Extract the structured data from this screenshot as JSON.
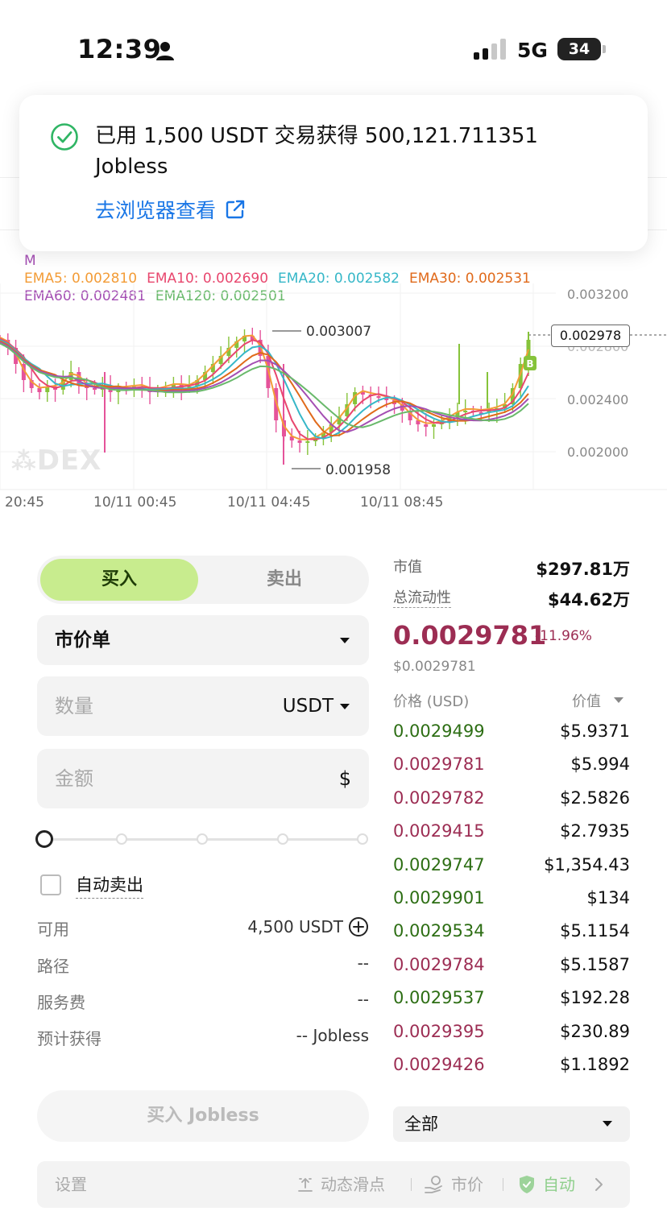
{
  "status_bar": {
    "time": "12:39",
    "network": "5G",
    "battery": "34"
  },
  "toast": {
    "message": "已用 1,500 USDT 交易获得 500,121.711351 Jobless",
    "link": "去浏览器查看"
  },
  "chart": {
    "ema_line1": [
      {
        "label": "EMA5: 0.002810",
        "color": "#f39c37"
      },
      {
        "label": "EMA10: 0.002690",
        "color": "#e8476e"
      },
      {
        "label": "EMA20: 0.002582",
        "color": "#36b7c8"
      },
      {
        "label": "EMA30: 0.002531",
        "color": "#e06a1b"
      }
    ],
    "ema_line2": [
      {
        "label": "EMA60: 0.002481",
        "color": "#a44fb3"
      },
      {
        "label": "EMA120: 0.002501",
        "color": "#69b96b"
      }
    ],
    "ema_partial": "M",
    "price_axis": [
      "0.003200",
      "0.002800",
      "0.002400",
      "0.002000"
    ],
    "current_price_tag": "0.002978",
    "high_note": "0.003007",
    "low_note": "0.001958",
    "time_axis": [
      "20:45",
      "10/11 00:45",
      "10/11 04:45",
      "10/11 08:45"
    ],
    "watermark": "DEX",
    "marker": "B"
  },
  "trade_panel": {
    "tab_buy": "买入",
    "tab_sell": "卖出",
    "order_type": "市价单",
    "quantity_placeholder": "数量",
    "quantity_unit": "USDT",
    "amount_placeholder": "金额",
    "amount_unit": "$",
    "auto_sell": "自动卖出",
    "available_label": "可用",
    "available_value": "4,500 USDT",
    "route_label": "路径",
    "route_value": "--",
    "fee_label": "服务费",
    "fee_value": "--",
    "expected_label": "预计获得",
    "expected_value": "-- Jobless",
    "buy_button": "买入 Jobless"
  },
  "market": {
    "mcap_label": "市值",
    "mcap_value": "$297.81万",
    "liquidity_label": "总流动性",
    "liquidity_value": "$44.62万",
    "price": "0.0029781",
    "change": "-11.96%",
    "usd_price": "$0.0029781",
    "col_price": "价格 (USD)",
    "col_value": "价值",
    "trades": [
      {
        "price": "0.0029499",
        "value": "$5.9371",
        "side": "buy"
      },
      {
        "price": "0.0029781",
        "value": "$5.994",
        "side": "sell"
      },
      {
        "price": "0.0029782",
        "value": "$2.5826",
        "side": "sell"
      },
      {
        "price": "0.0029415",
        "value": "$2.7935",
        "side": "sell"
      },
      {
        "price": "0.0029747",
        "value": "$1,354.43",
        "side": "buy"
      },
      {
        "price": "0.0029901",
        "value": "$134",
        "side": "buy"
      },
      {
        "price": "0.0029534",
        "value": "$5.1154",
        "side": "buy"
      },
      {
        "price": "0.0029784",
        "value": "$5.1587",
        "side": "sell"
      },
      {
        "price": "0.0029537",
        "value": "$192.28",
        "side": "buy"
      },
      {
        "price": "0.0029395",
        "value": "$230.89",
        "side": "sell"
      },
      {
        "price": "0.0029426",
        "value": "$1.1892",
        "side": "sell"
      }
    ],
    "filter": "全部"
  },
  "settings": {
    "label": "设置",
    "slippage": "动态滑点",
    "price_mode": "市价",
    "auto": "自动"
  }
}
